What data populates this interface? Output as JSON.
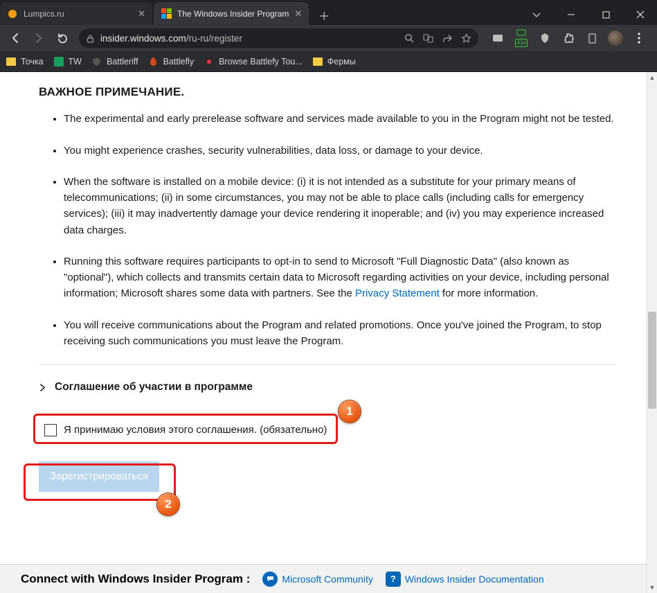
{
  "tabs": [
    {
      "title": "Lumpics.ru"
    },
    {
      "title": "The Windows Insider Program"
    }
  ],
  "omnibox": {
    "host": "insider.windows.com",
    "path": "/ru-ru/register"
  },
  "bookmarks": [
    {
      "label": "Точка"
    },
    {
      "label": "TW"
    },
    {
      "label": "Battleriff"
    },
    {
      "label": "Battlefly"
    },
    {
      "label": "Browse Battlefy Tou..."
    },
    {
      "label": "Фермы"
    }
  ],
  "notice_heading": "ВАЖНОЕ ПРИМЕЧАНИЕ.",
  "bullets": [
    "The experimental and early prerelease software and services made available to you in the Program might not be tested.",
    "You might experience crashes, security vulnerabilities, data loss, or damage to your device.",
    "When the software is installed on a mobile device: (i) it is not intended as a substitute for your primary means of telecommunications; (ii) in some circumstances, you may not be able to place calls (including calls for emergency services); (iii) it may inadvertently damage your device rendering it inoperable; and (iv) you may experience increased data charges.",
    "Running this software requires participants to opt-in to send to Microsoft \"Full Diagnostic Data\" (also known as \"optional\"), which collects and transmits certain data to Microsoft regarding activities on your device, including personal information; Microsoft shares some data with partners. See the ",
    "You will receive communications about the Program and related promotions. Once you've joined the Program, to stop receiving such communications you must leave the Program."
  ],
  "privacy_link": "Privacy Statement",
  "privacy_tail": " for more information.",
  "expander_label": "Соглашение об участии в программе",
  "accept_label": "Я принимаю условия этого соглашения. (обязательно)",
  "register_label": "Зарегистрироваться",
  "callouts": {
    "one": "1",
    "two": "2"
  },
  "footer": {
    "lead": "Connect with Windows Insider Program :",
    "community": "Microsoft Community",
    "docs": "Windows Insider Documentation"
  },
  "badge": "41s"
}
